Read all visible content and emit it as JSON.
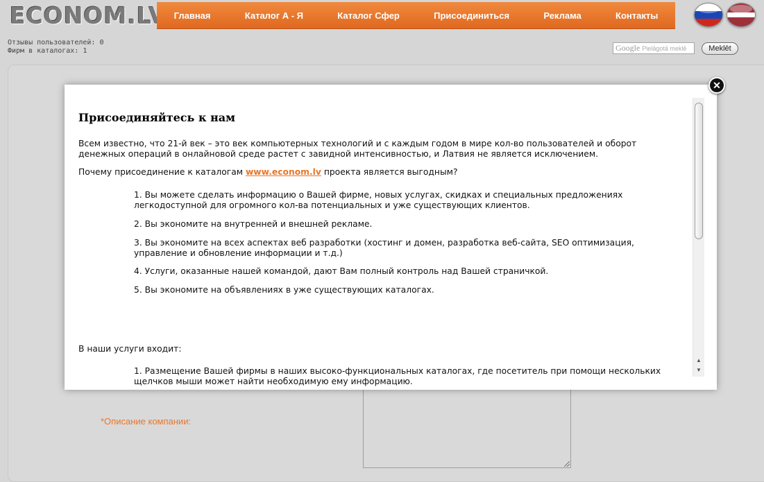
{
  "header": {
    "logo": "ECONOM.LV",
    "nav": [
      "Главная",
      "Каталог А - Я",
      "Каталог Сфер",
      "Присоединиться",
      "Реклама",
      "Контакты"
    ],
    "flags": [
      "ru-flag-icon",
      "lv-flag-icon"
    ]
  },
  "stats": {
    "reviews": "Отзывы пользователей: 0",
    "firms": "Фирм в каталогах: 1"
  },
  "search": {
    "google_mark": "Google",
    "placeholder": "Pielāgotā meklē",
    "button": "Meklēt"
  },
  "form": {
    "description_label": "*Описание компании:"
  },
  "modal": {
    "title": "Присоединяйтесь к нам",
    "intro": "Всем известно, что 21-й век – это век компьютерных технологий и с каждым годом в мире кол-во пользователей и оборот денежных операций в онлайновой среде растет с завидной интенсивностью, и Латвия не является исключением.",
    "question_prefix": "Почему присоединение к каталогам",
    "question_link": "www.econom.lv",
    "question_suffix": "проекта является выгодным?",
    "benefits": [
      "1. Вы можете сделать информацию о Вашей фирме, новых услугах, скидках и специальных предложениях легкодоступной для огромного кол-ва потенциальных и уже существующих клиентов.",
      "2. Вы экономите на внутренней и внешней рекламе.",
      "3. Вы экономите на всех аспектах веб разработки (хостинг и домен, разработка веб-сайта, SEO оптимизация, управление и обновление информации и т.д.)",
      "4. Услуги, оказанные нашей командой, дают Вам полный контроль над Вашей страничкой.",
      "5. Вы экономите на объявлениях в уже существующих каталогах."
    ],
    "services_heading": "В наши услуги входит:",
    "services": [
      "1. Размещение Вашей фирмы в наших высоко-функциональных каталогах, где посетитель при помощи нескольких щелчков мыши может найти необходимую ему информацию."
    ]
  },
  "colors": {
    "nav_orange": "#e8752c",
    "link_orange": "#e8762a"
  }
}
